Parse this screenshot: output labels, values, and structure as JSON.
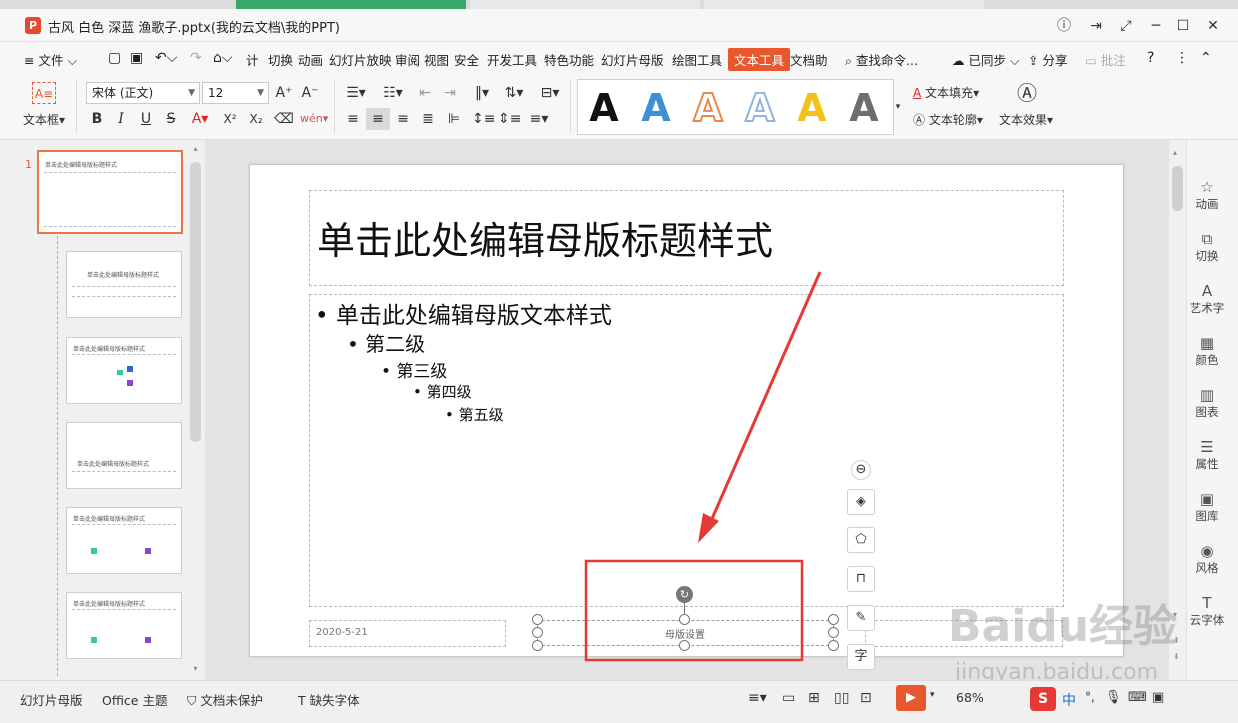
{
  "window": {
    "title": "古风 白色 深蓝 渔歌子.pptx(我的云文档\\我的PPT)",
    "app_logo": "P",
    "controls": [
      "ⓘ",
      "⇥",
      "⤢",
      "─",
      "☐",
      "✕"
    ]
  },
  "menu": {
    "file": "文件",
    "items": [
      "计",
      "切换",
      "动画",
      "幻灯片放映",
      "审阅",
      "视图",
      "安全",
      "开发工具",
      "特色功能",
      "幻灯片母版",
      "绘图工具",
      "文本工具",
      "文档助"
    ],
    "active": "文本工具",
    "search": "查找命令...",
    "sync": "已同步",
    "share": "分享",
    "comment": "批注"
  },
  "ribbon": {
    "textbox": "文本框",
    "font_name": "宋体 (正文)",
    "font_size": "12",
    "styles": [
      {
        "letter": "A",
        "color": "#111111"
      },
      {
        "letter": "A",
        "color": "#3f8fd6"
      },
      {
        "letter": "A",
        "color": "#e8894a"
      },
      {
        "letter": "A",
        "color": "#8fb4e0"
      },
      {
        "letter": "A",
        "color": "#f2c21a"
      },
      {
        "letter": "A",
        "color": "#6e6e6e"
      }
    ],
    "text_fill": "文本填充",
    "text_outline": "文本轮廓",
    "text_effect": "文本效果"
  },
  "thumbnails": {
    "first_number": "1",
    "title_text": "单击此处编辑母版标题样式"
  },
  "slide": {
    "title": "单击此处编辑母版标题样式",
    "level1": "单击此处编辑母版文本样式",
    "level2": "第二级",
    "level3": "第三级",
    "level4": "第四级",
    "level5": "第五级",
    "date": "2020-5-21",
    "footer": "母版设置"
  },
  "float_tools": [
    "⊖",
    "◈",
    "⬠",
    "⊓",
    "✎",
    "字"
  ],
  "right_panel": [
    {
      "label": "动画",
      "icon": "☆"
    },
    {
      "label": "切换",
      "icon": "⧉"
    },
    {
      "label": "艺术字",
      "icon": "A"
    },
    {
      "label": "颜色",
      "icon": "▦"
    },
    {
      "label": "图表",
      "icon": "▥"
    },
    {
      "label": "属性",
      "icon": "☰"
    },
    {
      "label": "图库",
      "icon": "▣"
    },
    {
      "label": "风格",
      "icon": "◉"
    },
    {
      "label": "云字体",
      "icon": "T"
    }
  ],
  "status": {
    "view": "幻灯片母版",
    "theme": "Office 主题",
    "protect": "文档未保护",
    "missing_font": "缺失字体",
    "zoom": "68%",
    "ime": "中"
  },
  "watermark": {
    "main": "Baidu经验",
    "sub": "jingyan.baidu.com"
  },
  "colors": {
    "accent": "#e8572e",
    "annotation": "#e53935"
  }
}
